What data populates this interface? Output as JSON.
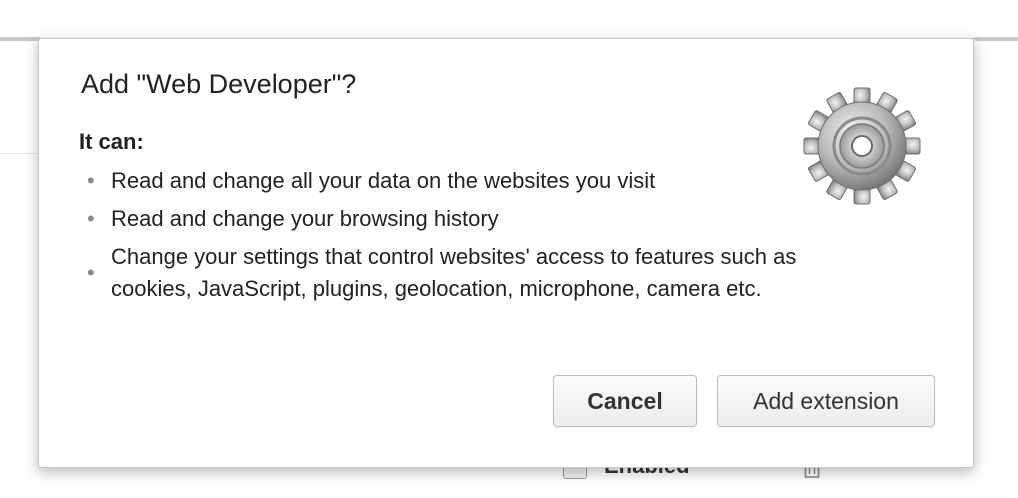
{
  "background": {
    "enabled_label": "Enabled"
  },
  "dialog": {
    "title": "Add \"Web Developer\"?",
    "subtitle": "It can:",
    "permissions": [
      "Read and change all your data on the websites you visit",
      "Read and change your browsing history",
      "Change your settings that control websites' access to features such as cookies, JavaScript, plugins, geolocation, microphone, camera etc."
    ],
    "icon": "gear-icon",
    "cancel_label": "Cancel",
    "add_label": "Add extension"
  },
  "colors": {
    "text": "#222222",
    "bullet": "#8a8a8a",
    "button_border": "#bdbdbd"
  }
}
